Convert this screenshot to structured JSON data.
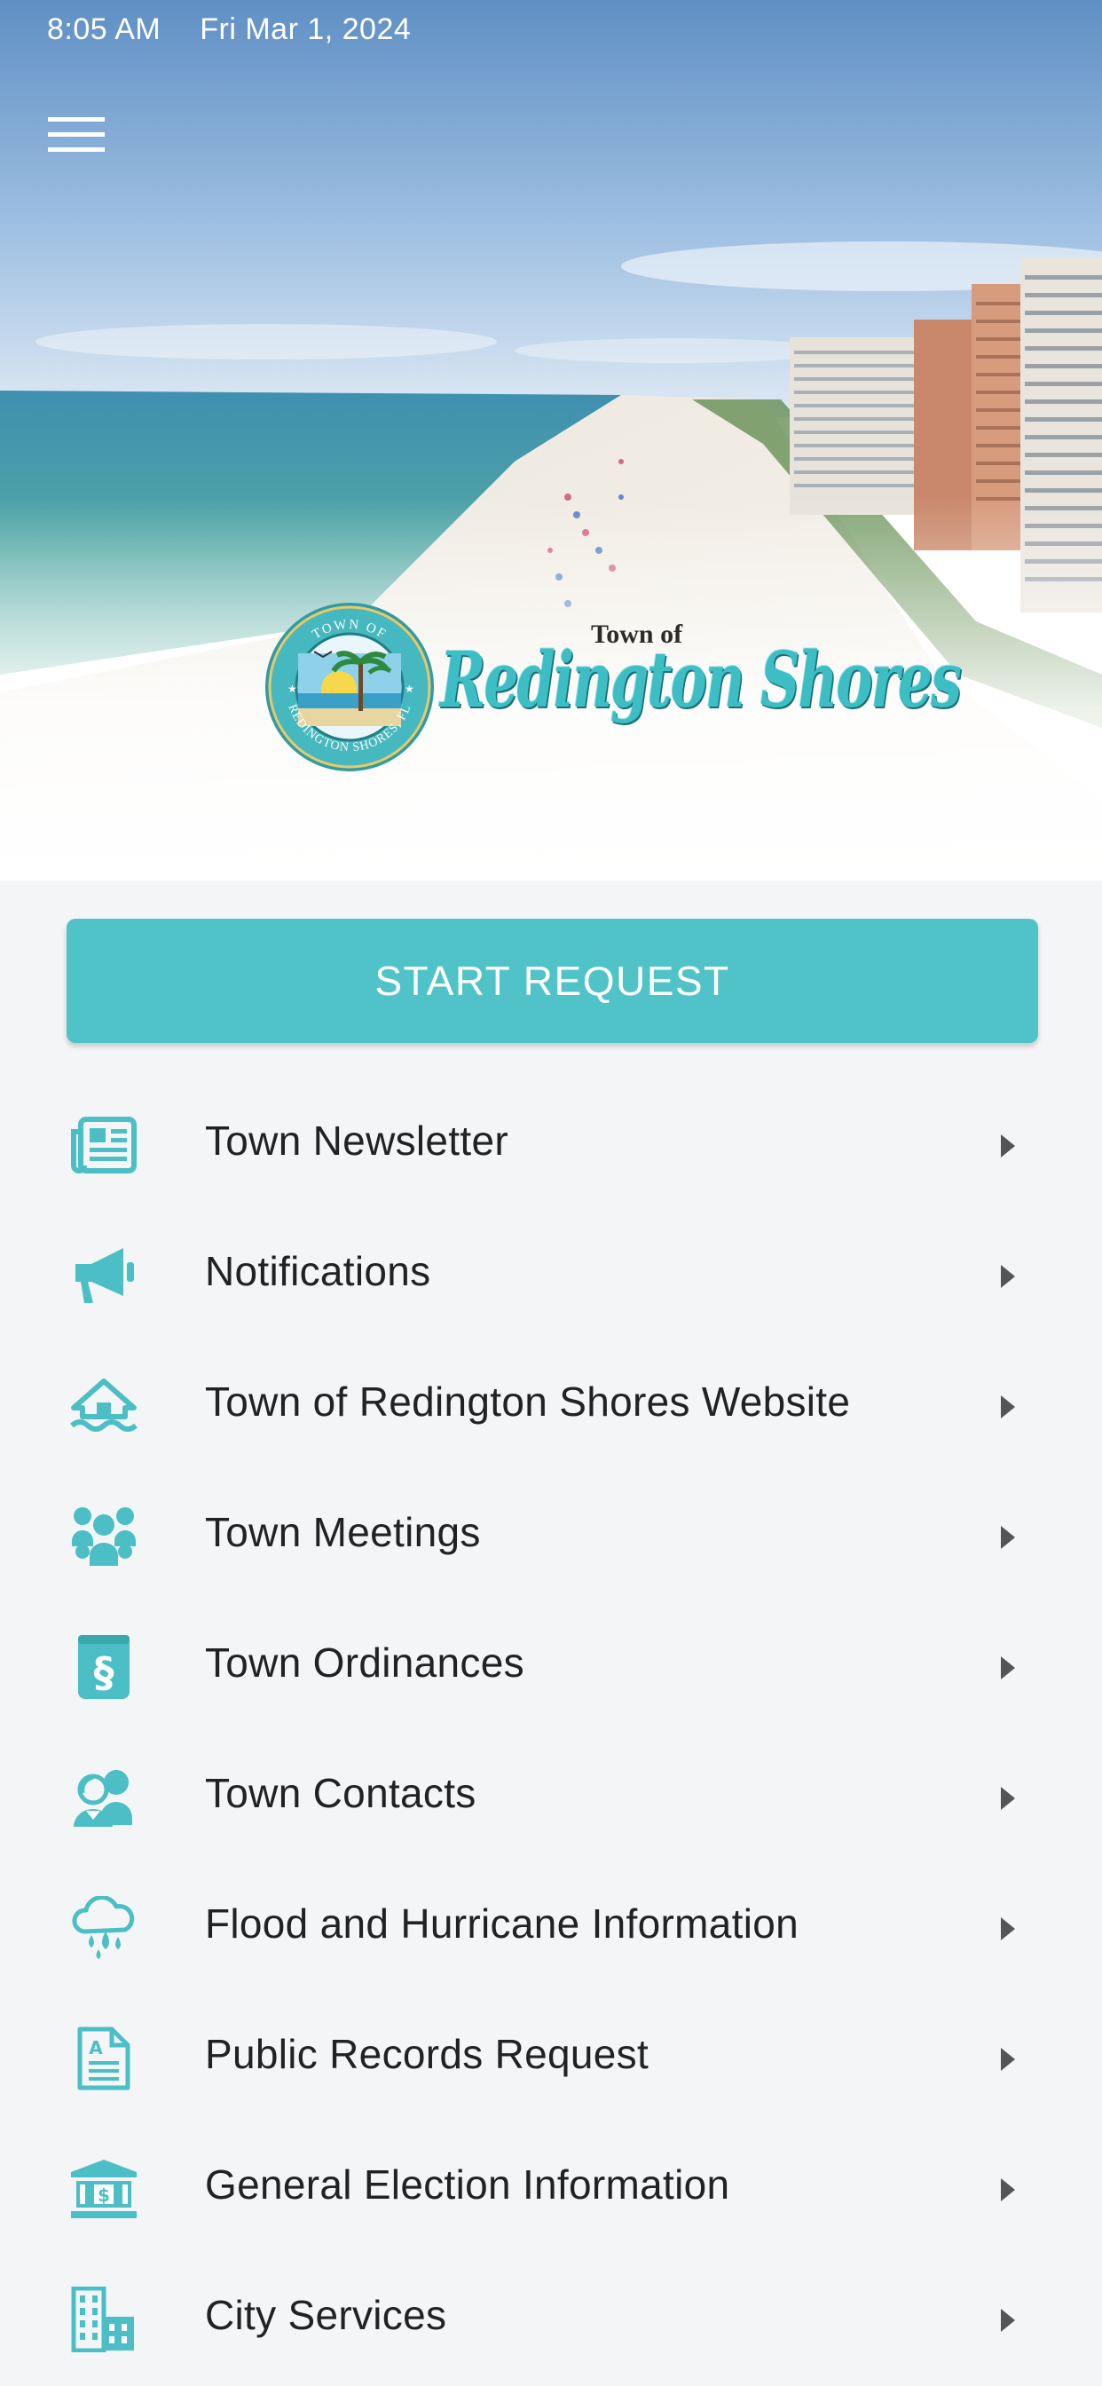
{
  "status_bar": {
    "time": "8:05 AM",
    "date": "Fri Mar 1, 2024"
  },
  "header": {
    "menu_icon": "hamburger-menu-icon",
    "logo": {
      "seal_text_top": "TOWN OF",
      "seal_text_bottom": "REDINGTON SHORES, FL",
      "town_of": "Town of",
      "name": "Redington Shores"
    }
  },
  "main": {
    "start_request_label": "START REQUEST",
    "menu_items": [
      {
        "label": "Town Newsletter",
        "icon": "newspaper-icon"
      },
      {
        "label": "Notifications",
        "icon": "megaphone-icon"
      },
      {
        "label": "Town of Redington Shores Website",
        "icon": "house-water-icon"
      },
      {
        "label": "Town Meetings",
        "icon": "people-group-icon"
      },
      {
        "label": "Town Ordinances",
        "icon": "section-book-icon"
      },
      {
        "label": "Town Contacts",
        "icon": "contacts-people-icon"
      },
      {
        "label": "Flood and Hurricane Information",
        "icon": "cloud-rain-icon"
      },
      {
        "label": "Public Records Request",
        "icon": "document-icon"
      },
      {
        "label": "General Election Information",
        "icon": "government-building-icon"
      },
      {
        "label": "City Services",
        "icon": "city-buildings-icon"
      }
    ]
  },
  "colors": {
    "accent": "#50c3c8",
    "icon": "#4bbfc5",
    "background": "#f4f5f7",
    "text": "#222222",
    "chevron": "#555555"
  }
}
